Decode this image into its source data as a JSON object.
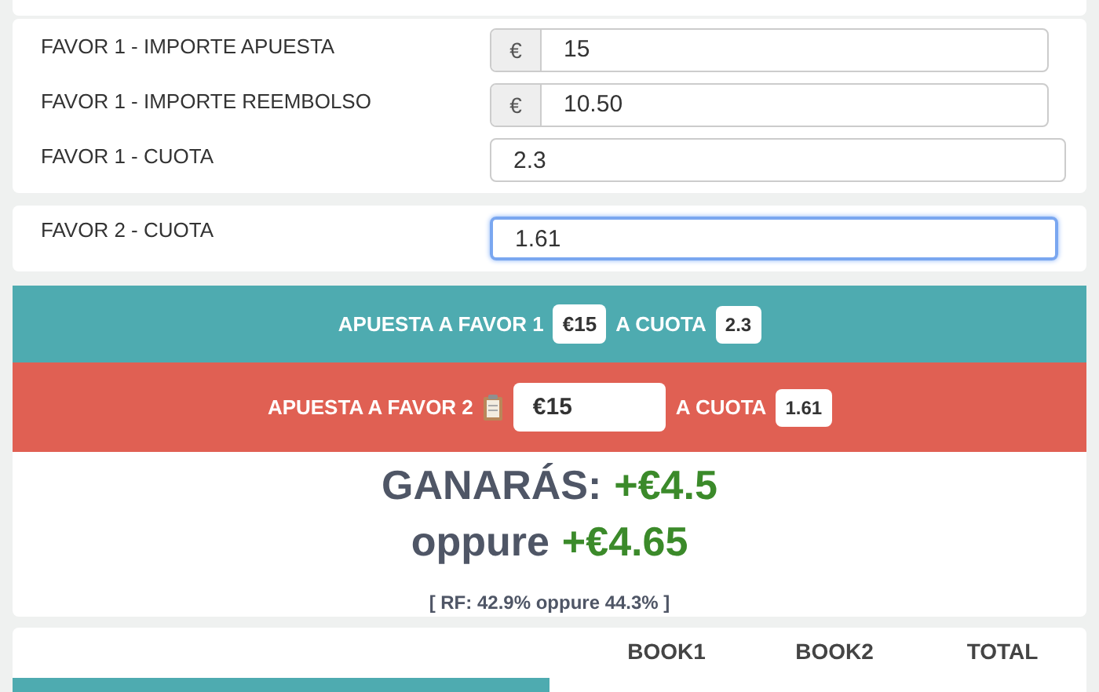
{
  "fields": [
    {
      "label": "FAVOR 1 - IMPORTE APUESTA",
      "prefix": "€",
      "value": "15"
    },
    {
      "label": "FAVOR 1 - IMPORTE REEMBOLSO",
      "prefix": "€",
      "value": "10.50"
    },
    {
      "label": "FAVOR 1 - CUOTA",
      "value": "2.3"
    }
  ],
  "favor2": {
    "label": "FAVOR 2 - CUOTA",
    "value": "1.61",
    "focused": true
  },
  "bets": [
    {
      "kind": "back",
      "label": "APUESTA A FAVOR 1",
      "stake": "€15",
      "odds_label": "A CUOTA",
      "odds": "2.3"
    },
    {
      "kind": "lay",
      "label": "APUESTA A FAVOR 2",
      "stake": "€15",
      "odds_label": "A CUOTA",
      "odds": "1.61"
    }
  ],
  "result": {
    "label": "GANARÁS:",
    "value": "+€4.5",
    "alt_label": "oppure",
    "alt_value": "+€4.65",
    "rf": "[ RF: 42.9% oppure 44.3% ]"
  },
  "table": {
    "columns": [
      "BOOK1",
      "BOOK2",
      "TOTAL"
    ]
  }
}
